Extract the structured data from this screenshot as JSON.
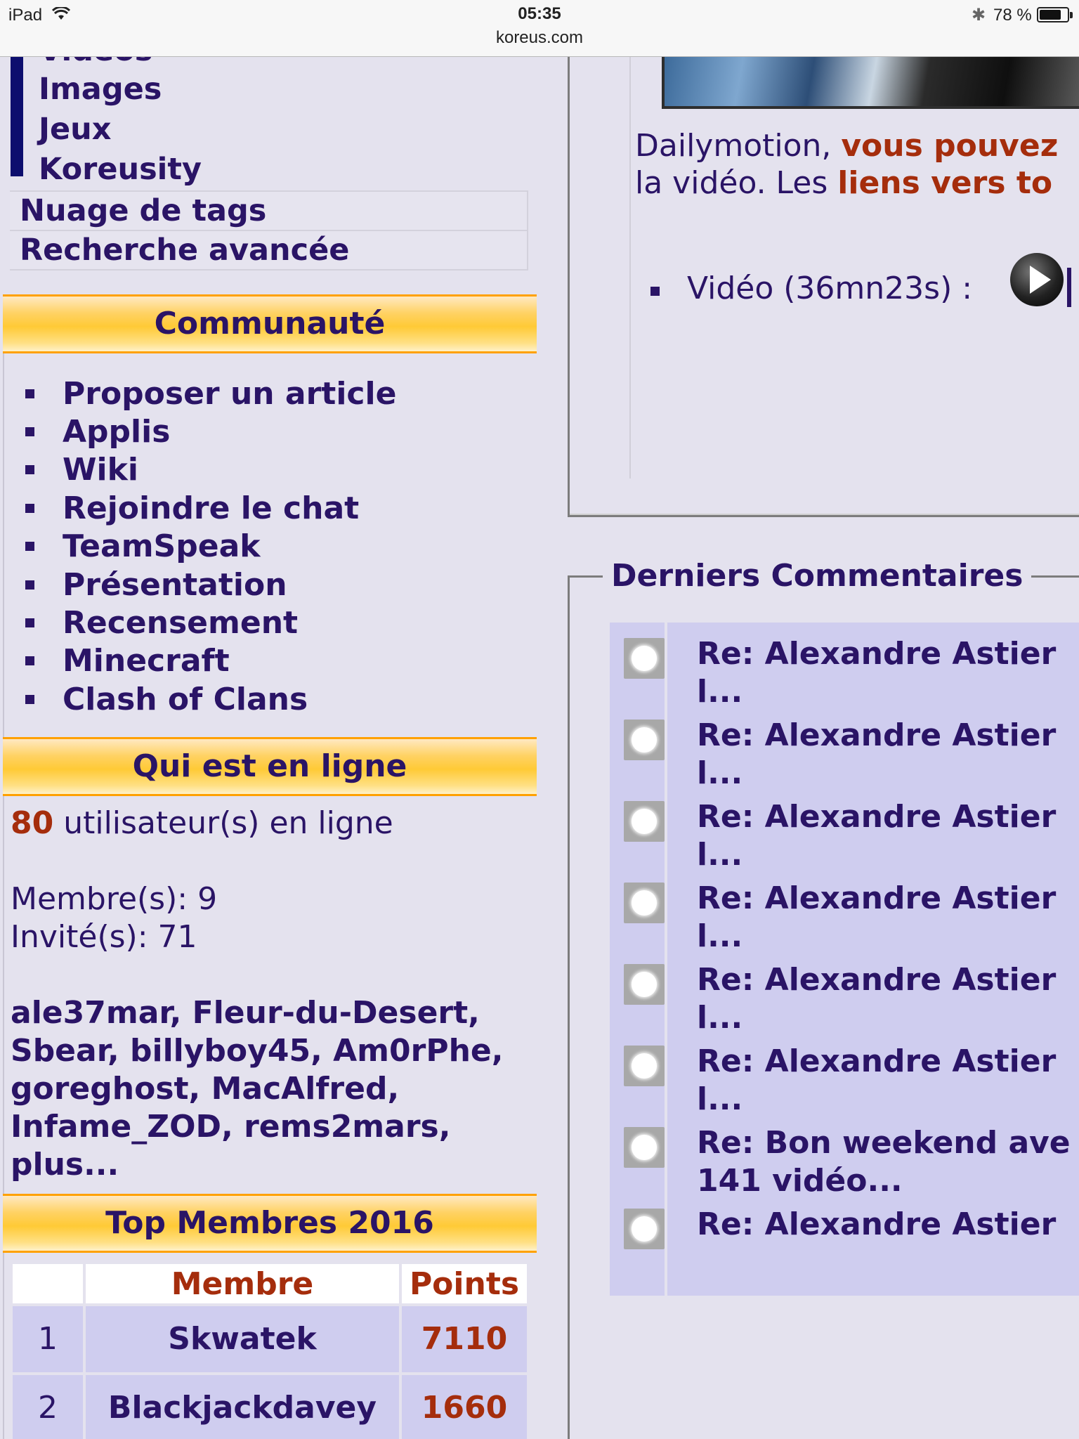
{
  "status_bar": {
    "device": "iPad",
    "time": "05:35",
    "url": "koreus.com",
    "battery_percent_text": "78 %",
    "battery_level": 0.78
  },
  "sidebar": {
    "sub_items": [
      {
        "label": "Videos"
      },
      {
        "label": "Images"
      },
      {
        "label": "Jeux"
      },
      {
        "label": "Koreusity"
      }
    ],
    "main_items": [
      {
        "label": "Nuage de tags"
      },
      {
        "label": "Recherche avancée"
      }
    ]
  },
  "community": {
    "title": "Communauté",
    "items": [
      {
        "label": "Proposer un article"
      },
      {
        "label": "Applis"
      },
      {
        "label": "Wiki"
      },
      {
        "label": "Rejoindre le chat"
      },
      {
        "label": "TeamSpeak"
      },
      {
        "label": "Présentation"
      },
      {
        "label": "Recensement"
      },
      {
        "label": "Minecraft"
      },
      {
        "label": "Clash of Clans"
      }
    ]
  },
  "online": {
    "title": "Qui est en ligne",
    "count": "80",
    "count_suffix": " utilisateur(s) en ligne",
    "members_line": "Membre(s): 9",
    "guests_line": "Invité(s): 71",
    "users": [
      "ale37mar",
      "Fleur-du-Desert",
      "Sbear",
      "billyboy45",
      "Am0rPhe",
      "goreghost",
      "MacAlfred",
      "Infame_ZOD",
      "rems2mars"
    ],
    "more": "plus..."
  },
  "top_members": {
    "title": "Top Membres 2016",
    "headers": {
      "rank": "",
      "member": "Membre",
      "points": "Points"
    },
    "rows": [
      {
        "rank": "1",
        "member": "Skwatek",
        "points": "7110"
      },
      {
        "rank": "2",
        "member": "Blackjackdavey",
        "points": "1660"
      }
    ]
  },
  "video": {
    "line1_plain": "Dailymotion, ",
    "line1_bold": "vous pouvez",
    "line2_plain": "la vidéo. Les ",
    "line2_bold": "liens vers to",
    "label": "Vidéo (36mn23s) :"
  },
  "comments": {
    "title": "Derniers Commentaires",
    "items": [
      {
        "title": "Re: Alexandre Astier\nl..."
      },
      {
        "title": "Re: Alexandre Astier\nl..."
      },
      {
        "title": "Re: Alexandre Astier\nl..."
      },
      {
        "title": "Re: Alexandre Astier\nl..."
      },
      {
        "title": "Re: Alexandre Astier\nl..."
      },
      {
        "title": "Re: Alexandre Astier\nl..."
      },
      {
        "title": "Re: Bon weekend ave\n141 vidéo..."
      },
      {
        "title": "Re: Alexandre Astier"
      }
    ]
  },
  "colors": {
    "text": "#2a1466",
    "accent": "#a52d0c",
    "header_gold": "#ffca36",
    "row_lilac": "#cfcdef",
    "page_bg": "#e4e2ee"
  }
}
